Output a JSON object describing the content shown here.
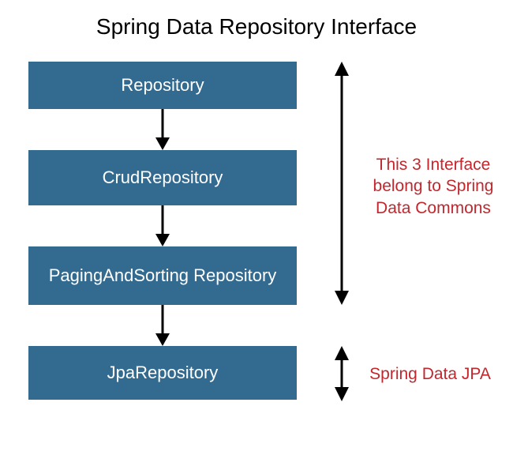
{
  "title": "Spring Data Repository Interface",
  "boxes": {
    "b0": "Repository",
    "b1": "CrudRepository",
    "b2": "PagingAndSorting Repository",
    "b3": "JpaRepository"
  },
  "annotations": {
    "commons": "This 3 Interface belong to Spring Data Commons",
    "jpa": "Spring Data JPA"
  },
  "colors": {
    "box_bg": "#336a90",
    "box_text": "#ffffff",
    "annotation": "#c1272d"
  }
}
